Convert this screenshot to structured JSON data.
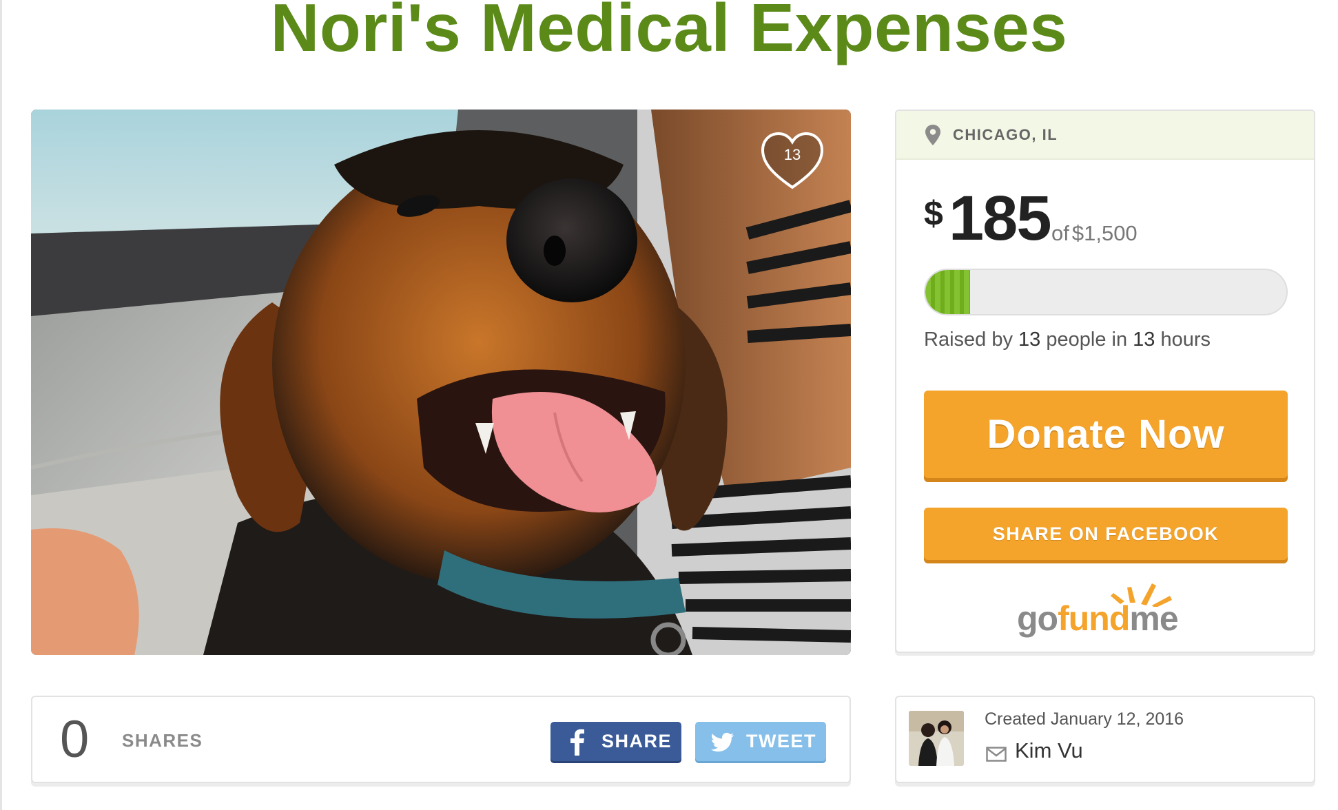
{
  "campaign": {
    "title": "Nori's Medical Expenses",
    "heart_count": "13",
    "location": "CHICAGO, IL",
    "currency_symbol": "$",
    "raised_amount": "185",
    "goal_prefix": "of",
    "goal_amount": "$1,500",
    "progress_fraction": 0.1233,
    "raised_by": {
      "prefix": "Raised by",
      "people": "13",
      "middle": "people in",
      "time": "13",
      "suffix": "hours"
    },
    "donate_label": "Donate Now",
    "share_facebook_label": "SHARE ON FACEBOOK",
    "logo": "gofundme"
  },
  "shares": {
    "count": "0",
    "label": "SHARES",
    "facebook_label": "SHARE",
    "twitter_label": "TWEET"
  },
  "creator": {
    "created": "Created January 12, 2016",
    "name": "Kim Vu"
  },
  "colors": {
    "title_green": "#5b8a19",
    "accent_orange": "#f4a32b",
    "progress_green": "#84c232",
    "facebook_blue": "#3a5a98",
    "twitter_blue": "#86bfe9",
    "location_bg": "#f3f7e6"
  },
  "icons": {
    "location": "map-pin-icon",
    "heart": "heart-icon",
    "facebook": "facebook-icon",
    "twitter": "twitter-icon",
    "mail": "mail-icon"
  }
}
